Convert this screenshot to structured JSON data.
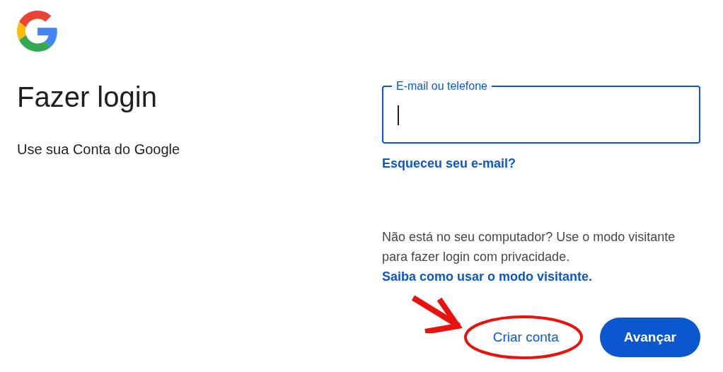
{
  "heading": "Fazer login",
  "subheading": "Use sua Conta do Google",
  "email_field": {
    "label": "E-mail ou telefone",
    "focused": true
  },
  "forgot_email_link": "Esqueceu seu e-mail?",
  "guest_note": {
    "text": "Não está no seu computador? Use o modo visitante para fazer login com privacidade.",
    "link": "Saiba como usar o modo visitante."
  },
  "buttons": [
    {
      "label": "Criar conta",
      "kind": "text",
      "circled": true
    },
    {
      "label": "Avançar",
      "kind": "filled",
      "circled": false
    }
  ]
}
